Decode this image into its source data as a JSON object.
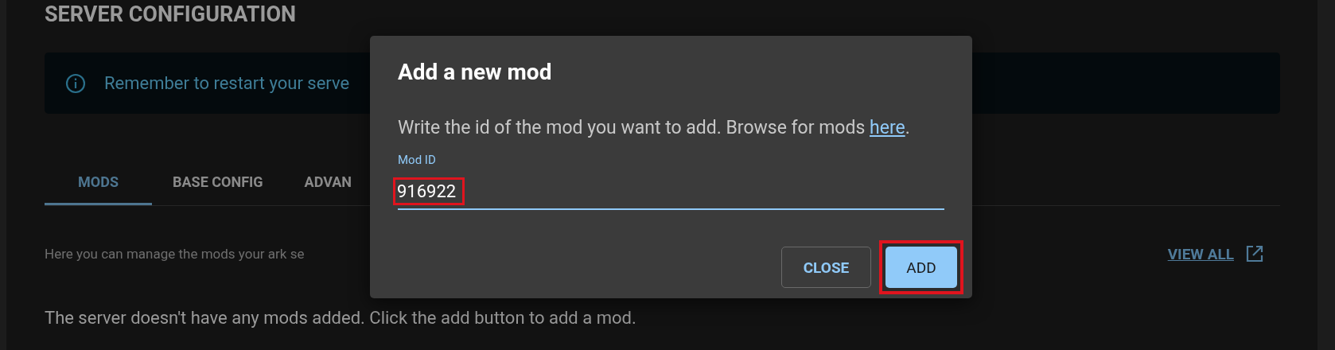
{
  "page": {
    "title": "SERVER CONFIGURATION"
  },
  "alert": {
    "text": "Remember to restart your serve"
  },
  "tabs": [
    {
      "label": "MODS",
      "selected": true
    },
    {
      "label": "BASE CONFIG",
      "selected": false
    },
    {
      "label": "ADVAN",
      "selected": false
    }
  ],
  "mods": {
    "description": "Here you can manage the mods your ark se",
    "view_all": "VIEW ALL",
    "empty_message": "The server doesn't have any mods added. Click the add button to add a mod."
  },
  "dialog": {
    "title": "Add a new mod",
    "text": "Write the id of the mod you want to add. Browse for mods ",
    "link": "here",
    "text_end": ".",
    "field": {
      "label": "Mod ID",
      "value": "916922",
      "highlighted": true
    },
    "buttons": [
      {
        "label": "CLOSE",
        "kind": "outlined",
        "highlighted": false
      },
      {
        "label": "ADD",
        "kind": "filled",
        "highlighted": true
      }
    ]
  }
}
